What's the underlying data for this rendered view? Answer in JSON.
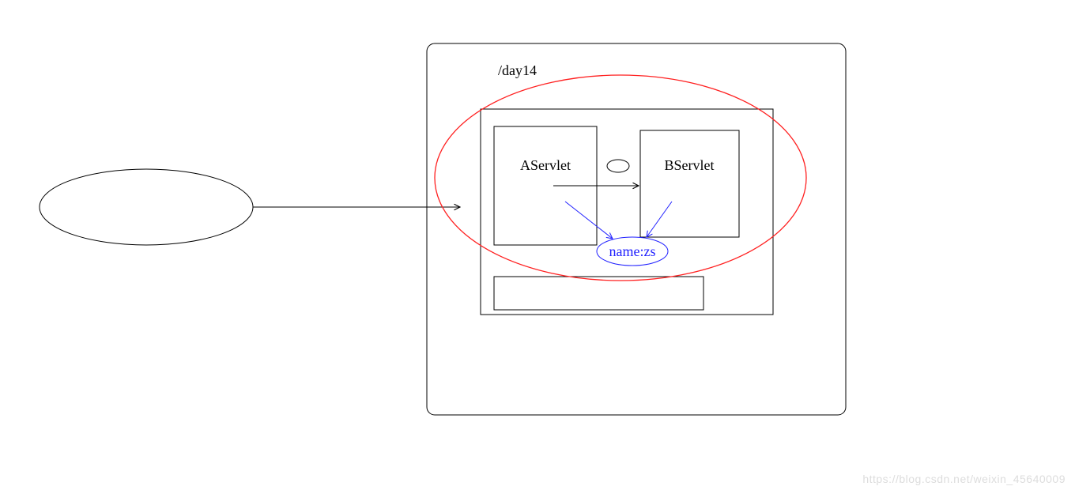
{
  "day14_label": "/day14",
  "a_servlet_label": "AServlet",
  "b_servlet_label": "BServlet",
  "shared_data_label": "name:zs",
  "watermark": "https://blog.csdn.net/weixin_45640009"
}
